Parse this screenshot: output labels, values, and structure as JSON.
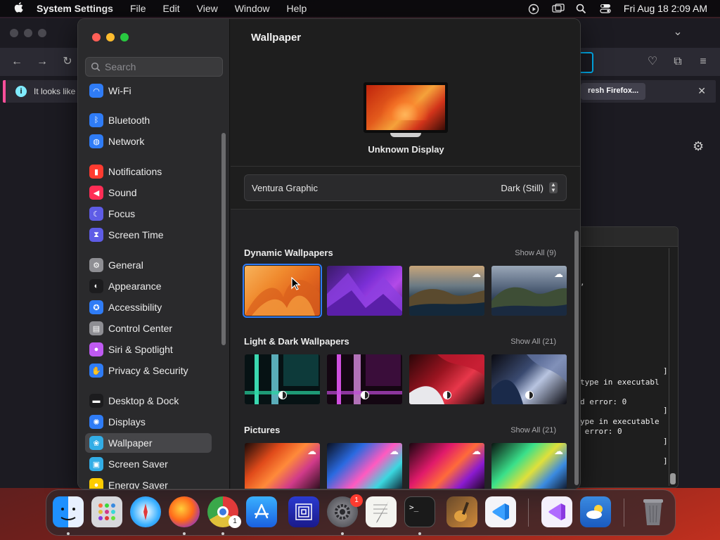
{
  "menubar": {
    "app_name": "System Settings",
    "menus": [
      "File",
      "Edit",
      "View",
      "Window",
      "Help"
    ],
    "datetime": "Fri Aug 18  2:09 AM"
  },
  "browser": {
    "notification_text": "It looks like y",
    "notification_button": "Refresh Firefox…",
    "partial_button_prefix": "resh Firefox..."
  },
  "terminal": {
    "lines": [
      "type in executabl",
      "d error: 0",
      "ype in executable",
      " error: 0"
    ],
    "brackets": [
      "]",
      "]",
      "]",
      "]"
    ]
  },
  "sidebar": {
    "search_placeholder": "Search",
    "items": [
      {
        "label": "Wi-Fi",
        "icon": "wifi-icon",
        "color": "#2f7cf6"
      },
      {
        "label": "Bluetooth",
        "icon": "bluetooth-icon",
        "color": "#2f7cf6"
      },
      {
        "label": "Network",
        "icon": "globe-icon",
        "color": "#2f7cf6"
      },
      {
        "label": "Notifications",
        "icon": "bell-icon",
        "color": "#ff3b30"
      },
      {
        "label": "Sound",
        "icon": "speaker-icon",
        "color": "#ff2d55"
      },
      {
        "label": "Focus",
        "icon": "moon-icon",
        "color": "#5e5ce6"
      },
      {
        "label": "Screen Time",
        "icon": "hourglass-icon",
        "color": "#5e5ce6"
      },
      {
        "label": "General",
        "icon": "gear-icon",
        "color": "#8e8e93"
      },
      {
        "label": "Appearance",
        "icon": "appearance-icon",
        "color": "#1c1c1e"
      },
      {
        "label": "Accessibility",
        "icon": "accessibility-icon",
        "color": "#2f7cf6"
      },
      {
        "label": "Control Center",
        "icon": "control-center-icon",
        "color": "#8e8e93"
      },
      {
        "label": "Siri & Spotlight",
        "icon": "siri-icon",
        "color": "#bf5af2"
      },
      {
        "label": "Privacy & Security",
        "icon": "hand-icon",
        "color": "#2f7cf6"
      },
      {
        "label": "Desktop & Dock",
        "icon": "dock-icon",
        "color": "#1c1c1e"
      },
      {
        "label": "Displays",
        "icon": "sun-icon",
        "color": "#2f7cf6"
      },
      {
        "label": "Wallpaper",
        "icon": "wallpaper-icon",
        "color": "#32ade6"
      },
      {
        "label": "Screen Saver",
        "icon": "screen-saver-icon",
        "color": "#32ade6"
      },
      {
        "label": "Energy Saver",
        "icon": "bulb-icon",
        "color": "#ffcc00"
      }
    ],
    "selected": "Wallpaper"
  },
  "content": {
    "title": "Wallpaper",
    "display_name": "Unknown Display",
    "picker_name": "Ventura Graphic",
    "picker_value": "Dark (Still)",
    "sections": [
      {
        "title": "Dynamic Wallpapers",
        "show_all": "Show All (9)"
      },
      {
        "title": "Light & Dark Wallpapers",
        "show_all": "Show All (21)"
      },
      {
        "title": "Pictures",
        "show_all": "Show All (21)"
      }
    ]
  },
  "dock": {
    "apps": [
      "Finder",
      "Launchpad",
      "Safari",
      "Firefox",
      "Chrome",
      "App Store",
      "Network Radar",
      "System Settings",
      "TextEdit",
      "Terminal",
      "GarageBand",
      "Visual Studio Code",
      "Visual Studio",
      "Weather",
      "Trash"
    ],
    "badges": {
      "Chrome": "1",
      "System Settings": "1"
    }
  }
}
